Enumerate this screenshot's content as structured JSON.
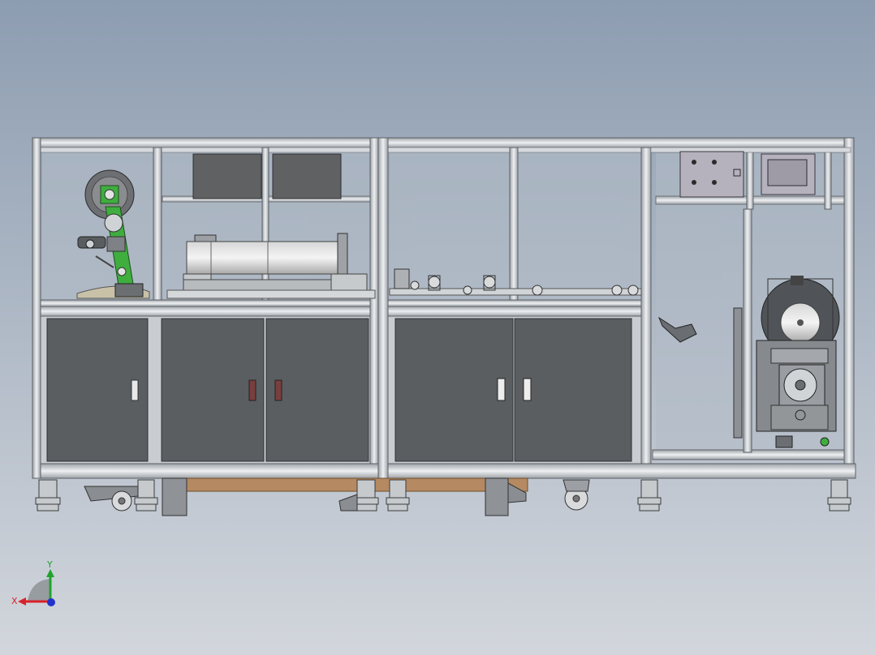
{
  "viewport": {
    "background_top": "#8d9db1",
    "background_bottom": "#d2d6dc"
  },
  "triad": {
    "x_label": "X",
    "y_label": "Y",
    "x_color": "#d8222a",
    "y_color": "#1fa32c",
    "z_color": "#2233cc"
  },
  "machine": {
    "frame_color": "#c9cdd2",
    "cabinet_door_color": "#5a5e61",
    "glass_color": "#b3bcc7",
    "arm_color": "#3fae3f",
    "wood_base_color": "#b58a62",
    "control_panel_color": "#b5b1bd"
  }
}
